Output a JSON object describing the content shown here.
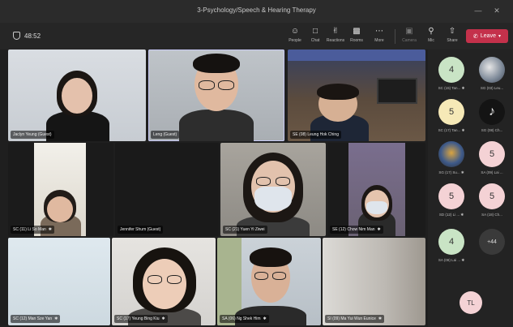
{
  "window": {
    "title": "3-Psychology/Speech & Hearing Therapy"
  },
  "toolbar": {
    "timer": "48:52",
    "buttons": [
      {
        "label": "People",
        "icon": "people-icon"
      },
      {
        "label": "Chat",
        "icon": "chat-icon"
      },
      {
        "label": "Reactions",
        "icon": "reactions-icon"
      },
      {
        "label": "Rooms",
        "icon": "rooms-icon"
      },
      {
        "label": "More",
        "icon": "more-icon"
      },
      {
        "label": "Camera",
        "icon": "camera-icon"
      },
      {
        "label": "Mic",
        "icon": "mic-icon"
      },
      {
        "label": "Share",
        "icon": "share-icon"
      }
    ],
    "leave_label": "Leave"
  },
  "tiles": [
    {
      "name": "Jaclyn Yeung (Guest)"
    },
    {
      "name": "Leng (Guest)"
    },
    {
      "name": "SE (08) Leung Hok Ching"
    },
    {
      "name": "SC (11) Li So Man"
    },
    {
      "name": "Jennifer Shum (Guest)"
    },
    {
      "name": "SC (21) Yuen Yi Ziwei"
    },
    {
      "name": "SE (12) Chow Nim Man"
    },
    {
      "name": "SC (12) Man Sze Yan"
    },
    {
      "name": "SC (17) Yeung Bing Kiu"
    },
    {
      "name": "SA (06) Ng Shek Him"
    },
    {
      "name": "SI (09) Ma Yui Wun Eunice"
    }
  ],
  "roster": [
    {
      "initial": "4",
      "label": "SC (15) Tan..."
    },
    {
      "initial": "",
      "label": "SG (03) Leu..."
    },
    {
      "initial": "5",
      "label": "SC (17) Tan..."
    },
    {
      "initial": "",
      "label": "SG (08) Ch..."
    },
    {
      "initial": "",
      "label": "SG (17) Su..."
    },
    {
      "initial": "5",
      "label": "SA (09) Lai ..."
    },
    {
      "initial": "5",
      "label": "SD (12) Li ..."
    },
    {
      "initial": "5",
      "label": "SA (18) Ch..."
    },
    {
      "initial": "4",
      "label": "SA (08) Lai ..."
    },
    {
      "initial": "+44",
      "label": ""
    }
  ],
  "self_initials": "TL",
  "colors": {
    "leave": "#c4314b",
    "selected_tile": "#c7c9f5"
  }
}
